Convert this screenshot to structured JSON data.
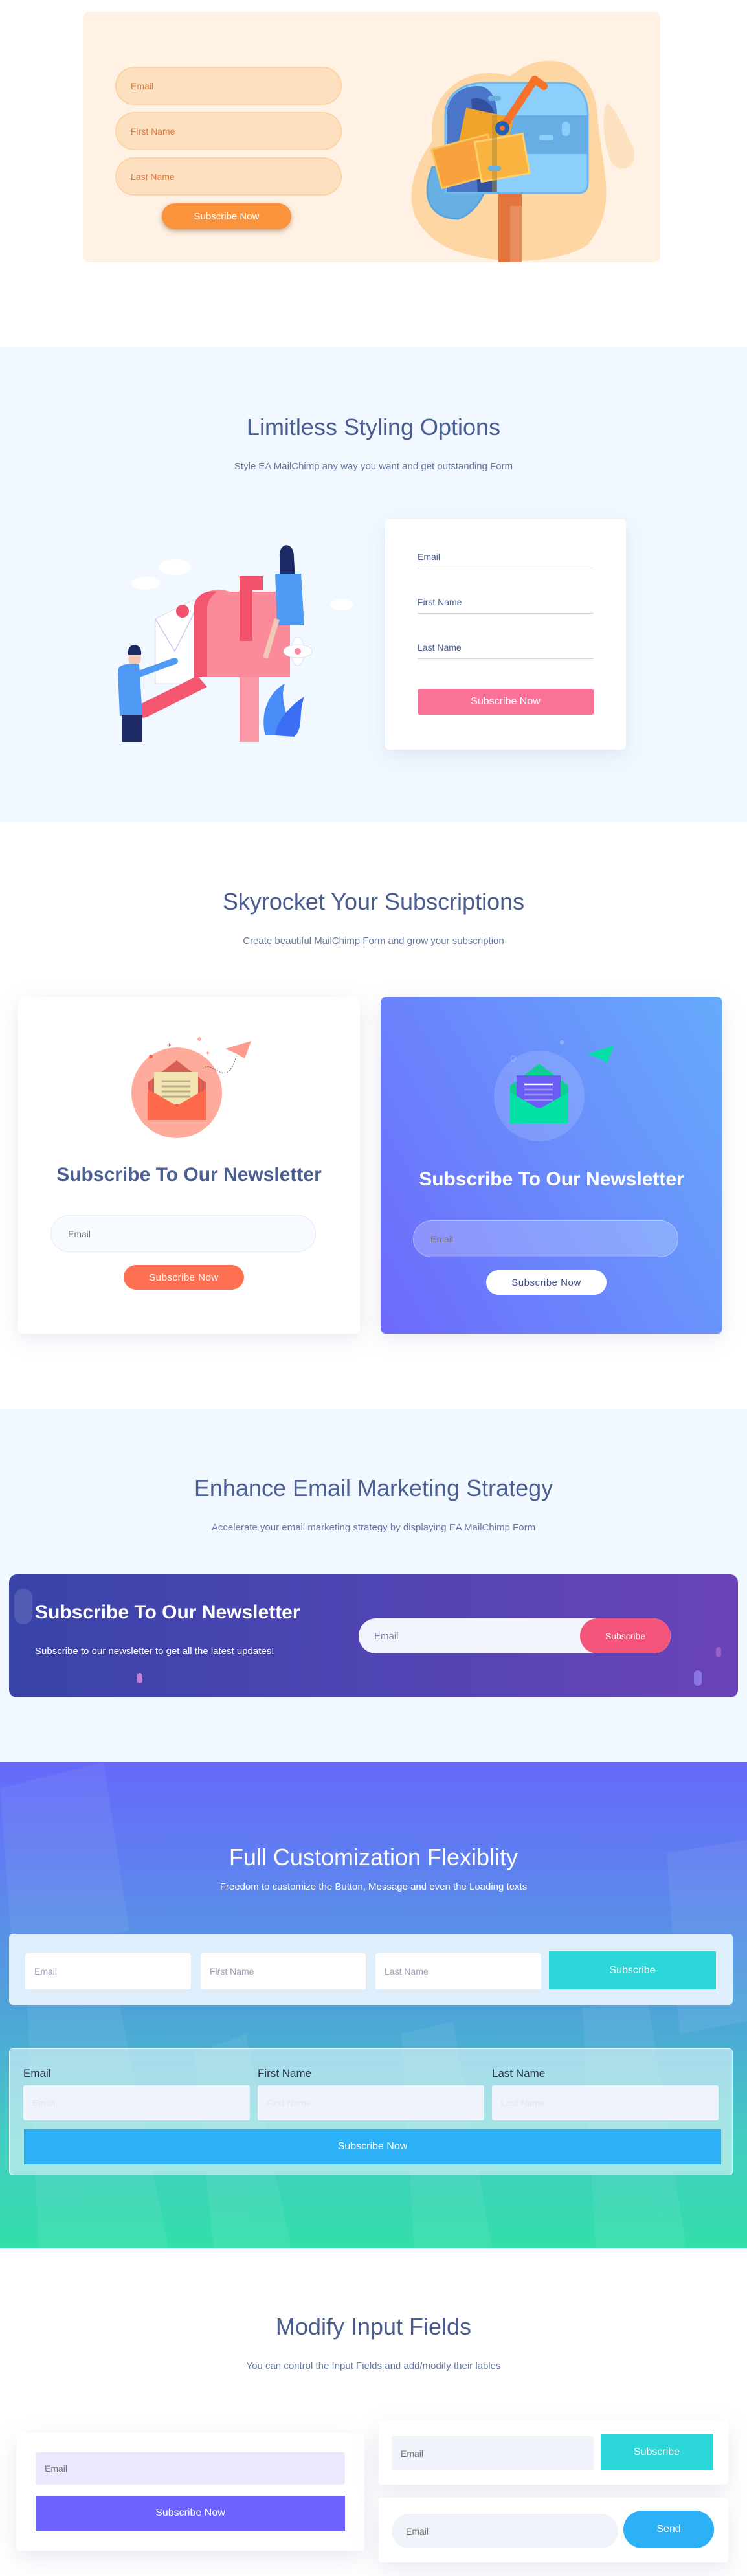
{
  "colors": {
    "orange_accent": "#fb923c",
    "pink_accent": "#fb7299",
    "coral_accent": "#ff6f52",
    "purple_accent": "#6c63ff",
    "teal_accent": "#2ad6d8",
    "sky_accent": "#2cb1f6",
    "heading_text": "#4a5e8f"
  },
  "hero_form": {
    "fields": [
      {
        "placeholder": "Email"
      },
      {
        "placeholder": "First Name"
      },
      {
        "placeholder": "Last Name"
      }
    ],
    "submit_label": "Subscribe Now",
    "illustration": "mailbox-with-letters-illustration"
  },
  "styling_section": {
    "title": "Limitless Styling Options",
    "subtitle": "Style EA MailChimp any way you want and get outstanding Form",
    "illustration": "people-at-mailbox-illustration",
    "form": {
      "fields": [
        {
          "placeholder": "Email"
        },
        {
          "placeholder": "First Name"
        },
        {
          "placeholder": "Last Name"
        }
      ],
      "submit_label": "Subscribe Now"
    }
  },
  "subscriptions_section": {
    "title": "Skyrocket Your Subscriptions",
    "subtitle": "Create beautiful MailChimp Form and grow your subscription",
    "cards": [
      {
        "heading": "Subscribe To Our Newsletter",
        "email_placeholder": "Email",
        "submit_label": "Subscribe Now",
        "icon": "open-envelope-icon"
      },
      {
        "heading": "Subscribe To Our Newsletter",
        "email_placeholder": "Email",
        "submit_label": "Subscribe Now",
        "icon": "open-envelope-icon"
      }
    ]
  },
  "marketing_section": {
    "title": "Enhance Email Marketing Strategy",
    "subtitle": "Accelerate your email marketing strategy by displaying EA MailChimp Form",
    "banner": {
      "heading": "Subscribe To Our Newsletter",
      "text": "Subscribe to our newsletter to get all the latest updates!",
      "email_placeholder": "Email",
      "submit_label": "Subscribe"
    }
  },
  "customization_section": {
    "title": "Full Customization Flexiblity",
    "subtitle": "Freedom to customize the Button, Message and even the Loading texts",
    "inline_form": {
      "fields": [
        {
          "placeholder": "Email"
        },
        {
          "placeholder": "First Name"
        },
        {
          "placeholder": "Last Name"
        }
      ],
      "submit_label": "Subscribe"
    },
    "labeled_form": {
      "fields": [
        {
          "label": "Email",
          "placeholder": "Email"
        },
        {
          "label": "First Name",
          "placeholder": "First Name"
        },
        {
          "label": "Last Name",
          "placeholder": "Last Name"
        }
      ],
      "submit_label": "Subscribe Now"
    }
  },
  "input_fields_section": {
    "title": "Modify Input Fields",
    "subtitle": "You can control the Input Fields and add/modify their lables",
    "forms": [
      {
        "email_placeholder": "Email",
        "submit_label": "Subscribe Now"
      },
      {
        "email_placeholder": "Email",
        "submit_label": "Subscribe"
      },
      {
        "email_placeholder": "Email",
        "submit_label": "Send"
      }
    ]
  }
}
